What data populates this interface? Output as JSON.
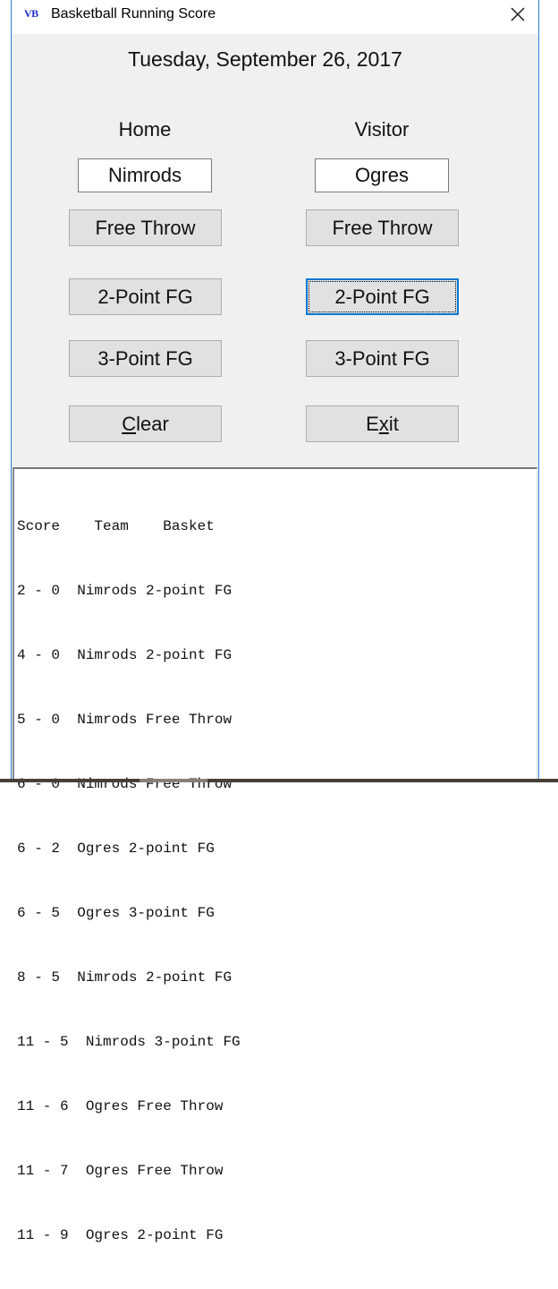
{
  "window": {
    "title": "Basketball Running Score",
    "app_icon": "VB",
    "close_icon": "close-icon"
  },
  "date": "Tuesday, September 26, 2017",
  "home": {
    "header": "Home",
    "team_name": "Nimrods",
    "free_throw_label": "Free Throw",
    "two_point_label": "2-Point FG",
    "three_point_label": "3-Point FG"
  },
  "visitor": {
    "header": "Visitor",
    "team_name": "Ogres",
    "free_throw_label": "Free Throw",
    "two_point_label": "2-Point FG",
    "three_point_label": "3-Point FG"
  },
  "actions": {
    "clear_prefix": "",
    "clear_mnemonic": "C",
    "clear_rest": "lear",
    "exit_prefix": "E",
    "exit_mnemonic": "x",
    "exit_rest": "it"
  },
  "focused_button": "visitor-2-point-fg-button",
  "log": {
    "header": "Score    Team    Basket",
    "lines": [
      "2 - 0  Nimrods 2-point FG",
      "4 - 0  Nimrods 2-point FG",
      "5 - 0  Nimrods Free Throw",
      "6 - 0  Nimrods Free Throw",
      "6 - 2  Ogres 2-point FG",
      "6 - 5  Ogres 3-point FG",
      "8 - 5  Nimrods 2-point FG",
      "11 - 5  Nimrods 3-point FG",
      "11 - 6  Ogres Free Throw",
      "11 - 7  Ogres Free Throw",
      "11 - 9  Ogres 2-point FG"
    ]
  },
  "colors": {
    "window_border": "#2b7fd6",
    "focus_border": "#0078d7",
    "button_face": "#e1e1e1",
    "form_background": "#f0f0f0",
    "app_icon": "#1a2fc8"
  }
}
